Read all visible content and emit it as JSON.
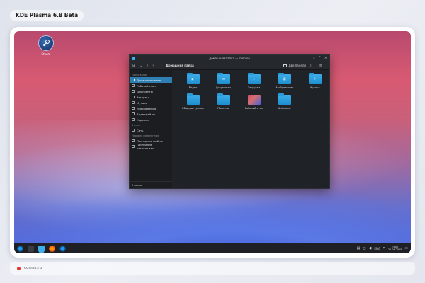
{
  "page_title": "KDE Plasma 6.8 Beta",
  "footer": {
    "url": "comss.ru",
    "dot_color": "#e3342f"
  },
  "desktop": {
    "icon_label": "Steam"
  },
  "window": {
    "title": "Домашняя папка — Dolphin",
    "breadcrumb": "Домашняя папка",
    "split_label": "Две панели",
    "accent": "#3daee9"
  },
  "sidebar": {
    "places_header": "Точки входа",
    "places": [
      {
        "label": "Домашняя папка",
        "active": true
      },
      {
        "label": "Рабочий стол"
      },
      {
        "label": "Документы"
      },
      {
        "label": "Загрузки"
      },
      {
        "label": "Музыка"
      },
      {
        "label": "Изображения"
      },
      {
        "label": "Видеофайлы"
      },
      {
        "label": "Корзина"
      }
    ],
    "network_header": "В сети",
    "network": [
      {
        "label": "Сеть"
      }
    ],
    "recent_header": "Недавно изменённые",
    "recent": [
      {
        "label": "Последние файлы"
      },
      {
        "label": "Последние расположен..."
      }
    ],
    "footer": "9 папок"
  },
  "folders": [
    {
      "label": "Видео",
      "glyph": "▶"
    },
    {
      "label": "Документы",
      "glyph": "≡"
    },
    {
      "label": "Загрузки",
      "glyph": "↓"
    },
    {
      "label": "Изображения",
      "glyph": "▣"
    },
    {
      "label": "Музыка",
      "glyph": "♪"
    },
    {
      "label": "Общедоступные",
      "glyph": ""
    },
    {
      "label": "Проекты",
      "glyph": ""
    },
    {
      "label": "Рабочий стол",
      "glyph": "",
      "image": true
    },
    {
      "label": "Шаблоны",
      "glyph": ""
    }
  ],
  "taskbar": {
    "lang": "ENG",
    "time": "23:07",
    "date": "22.04.2025"
  }
}
